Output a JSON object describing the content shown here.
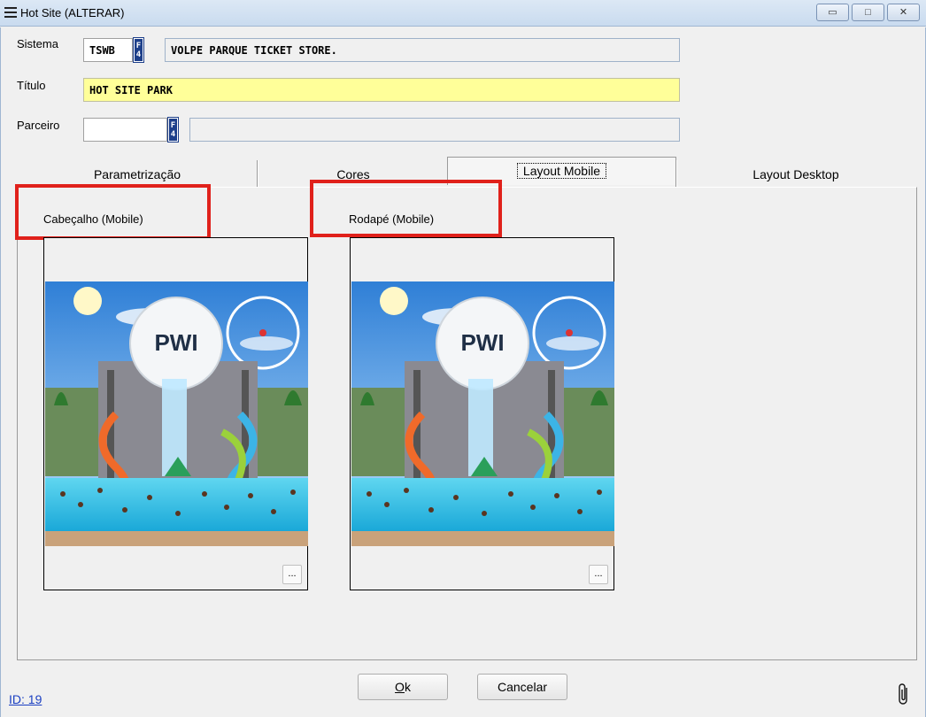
{
  "window": {
    "title": "Hot Site (ALTERAR)",
    "minimize_glyph": "▭",
    "maximize_glyph": "□",
    "close_glyph": "✕"
  },
  "form": {
    "sistema_label": "Sistema",
    "sistema_code": "TSWB",
    "sistema_name": "VOLPE PARQUE TICKET STORE.",
    "titulo_label": "Título",
    "titulo_value": "HOT SITE PARK",
    "parceiro_label": "Parceiro",
    "parceiro_code": "",
    "parceiro_name": "",
    "lookup_key_top": "F",
    "lookup_key_bottom": "4"
  },
  "tabs": [
    {
      "label": "Parametrização",
      "active": false
    },
    {
      "label": "Cores",
      "active": false
    },
    {
      "label": "Layout Mobile",
      "active": true
    },
    {
      "label": "Layout Desktop",
      "active": false
    }
  ],
  "layout_mobile": {
    "header_label": "Cabeçalho (Mobile)",
    "footer_label": "Rodapé (Mobile)",
    "browse_label": "...",
    "image_logo_text": "PWI",
    "highlight_color": "#e0211b"
  },
  "footer": {
    "ok_label": "Ok",
    "ok_mnemonic": "O",
    "ok_rest": "k",
    "cancel_label": "Cancelar",
    "id_link": "ID: 19"
  },
  "icons": [
    "menu-icon",
    "minimize-icon",
    "maximize-icon",
    "close-icon",
    "lookup-f4-icon",
    "attachment-icon"
  ]
}
